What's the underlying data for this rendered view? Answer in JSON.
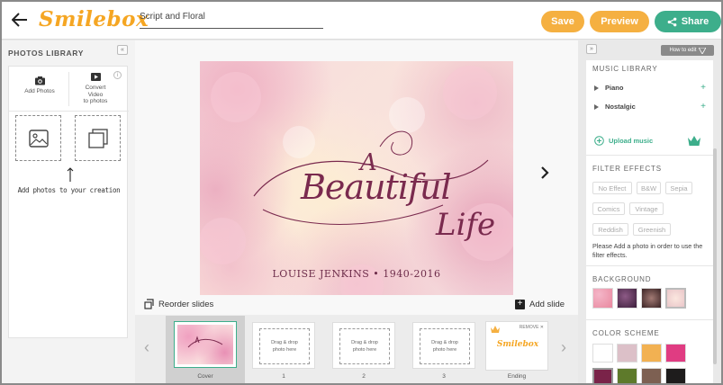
{
  "header": {
    "logo": "Smilebox",
    "doc_title": "Script and Floral",
    "save_label": "Save",
    "preview_label": "Preview",
    "share_label": "Share"
  },
  "left_panel": {
    "title": "PHOTOS LIBRARY",
    "collapse_glyph": "«",
    "add_photos": "Add Photos",
    "convert_video": [
      "Convert",
      "Video",
      "to photos"
    ],
    "info": "i",
    "hint": "Add photos to your creation"
  },
  "canvas": {
    "line_a": "A",
    "line_beautiful": "Beautiful",
    "line_life": "Life",
    "name_line": "LOUISE JENKINS • 1940-2016"
  },
  "center": {
    "reorder_label": "Reorder slides",
    "add_slide_label": "Add slide",
    "plus": "+"
  },
  "filmstrip": {
    "cover_label": "Cover",
    "dropzone_text": [
      "Drag & drop",
      "photo here"
    ],
    "slots": [
      {
        "label": "1"
      },
      {
        "label": "2"
      },
      {
        "label": "3"
      }
    ],
    "ending_label": "Ending",
    "ending_remove": "REMOVE",
    "ending_close": "✕",
    "ending_logo": "Smilebox"
  },
  "right_panel": {
    "expand_glyph": "»",
    "how_to_edit": "How to edit",
    "music_title": "MUSIC LIBRARY",
    "music_items": [
      {
        "label": "Piano",
        "plus": "+"
      },
      {
        "label": "Nostalgic",
        "plus": "+"
      }
    ],
    "upload_music": "Upload music",
    "filter_title": "FILTER EFFECTS",
    "filters": [
      "No Effect",
      "B&W",
      "Sepia",
      "Comics",
      "Vintage",
      "Reddish",
      "Greenish"
    ],
    "filter_note": "Please Add a photo in order to use the filter effects.",
    "background_title": "BACKGROUND",
    "color_title": "COLOR SCHEME",
    "colors": [
      "#ffffff",
      "#dcc0c8",
      "#f2b152",
      "#e03c82",
      "#7a2349",
      "#5e7a2b",
      "#7d6052",
      "#1e1c1c"
    ]
  }
}
